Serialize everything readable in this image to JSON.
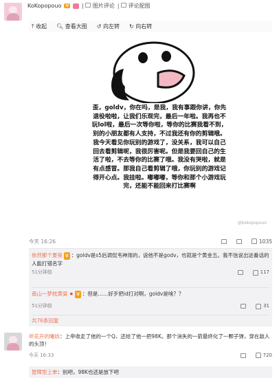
{
  "top_post": {
    "username": "KoKopopouo",
    "badge": "V",
    "links": [
      "图片评论",
      "评论配图"
    ]
  },
  "toolbar": {
    "items": [
      "收起",
      "查看大图",
      "向左转",
      "向右转"
    ]
  },
  "image": {
    "caption": "歪，goldv，你在吗，是我，我有事跟你讲，你先退役啦啦，让我们乐观完，最后一年啦。我再也不玩lol啦，最后一次等你啦，等你的比赛我看不到，别的小朋友都有人支持，不过我还有你的剪辑哦。我今天看见你玩别的游戏了，没关系，我可以自己回去看剪辑呢，我很厉害呢。但是我要回自己的生活了啦，不去等你的比赛了哦。我没有哭啦，就是有点感冒。那我自己看剪辑了哦，你玩别的游戏记得开心点。我挂啦。嘟嘟嘟，等你和那个小游戏玩完，还能不能回来打比赛啊",
    "watermark": "@kokopopouo"
  },
  "post_footer": {
    "time": "今天 16:26",
    "likes": "1035"
  },
  "comments": [
    {
      "name": "依然那个夏夜",
      "text": "：goldv是s5后调侃韦神用的，说他不是godv，也就是个黄金五。我不信说出这番话的人能打错名字",
      "time": "51分钟前",
      "likes": "117"
    },
    {
      "name": "南山一梦枕黄粱",
      "text": "：但是……好歹把id打对啊，goldv是啥？？",
      "time": "51分钟前",
      "likes": "31"
    }
  ],
  "more_comments": "共76条回复",
  "comment2": {
    "name": "听花开的曦妖",
    "text": "：上帝收走了他的一个Q，还给了他一把98K。那个消失的一箭最终化了一颗子弹，穿在敌人的头顶！",
    "time": "今天 16:33",
    "likes": "720"
  },
  "sub_reply": {
    "name": "智障型上单",
    "text": "：别吧，98K也还是放下吧"
  },
  "colors": {
    "link": "#eb7350",
    "comment_bg": "#f2f2f5"
  }
}
